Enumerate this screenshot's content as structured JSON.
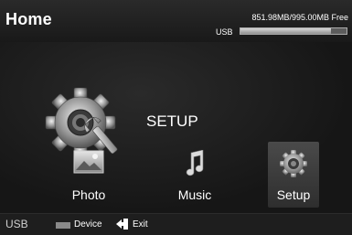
{
  "header": {
    "title": "Home",
    "storage_text": "851.98MB/995.00MB Free",
    "usb_label": "USB",
    "storage_free_fraction": 0.856
  },
  "main": {
    "heading": "SETUP",
    "big_icon": "gear-wrench-icon"
  },
  "tiles": [
    {
      "label": "Photo",
      "icon": "photo-icon",
      "selected": false
    },
    {
      "label": "Music",
      "icon": "music-note-icon",
      "selected": false
    },
    {
      "label": "Setup",
      "icon": "gear-icon",
      "selected": true
    }
  ],
  "footer": {
    "source": "USB",
    "device_label": "Device",
    "exit_label": "Exit"
  },
  "colors": {
    "background": "#141414",
    "text": "#ffffff",
    "bar_fill": "#c8c8c8"
  }
}
